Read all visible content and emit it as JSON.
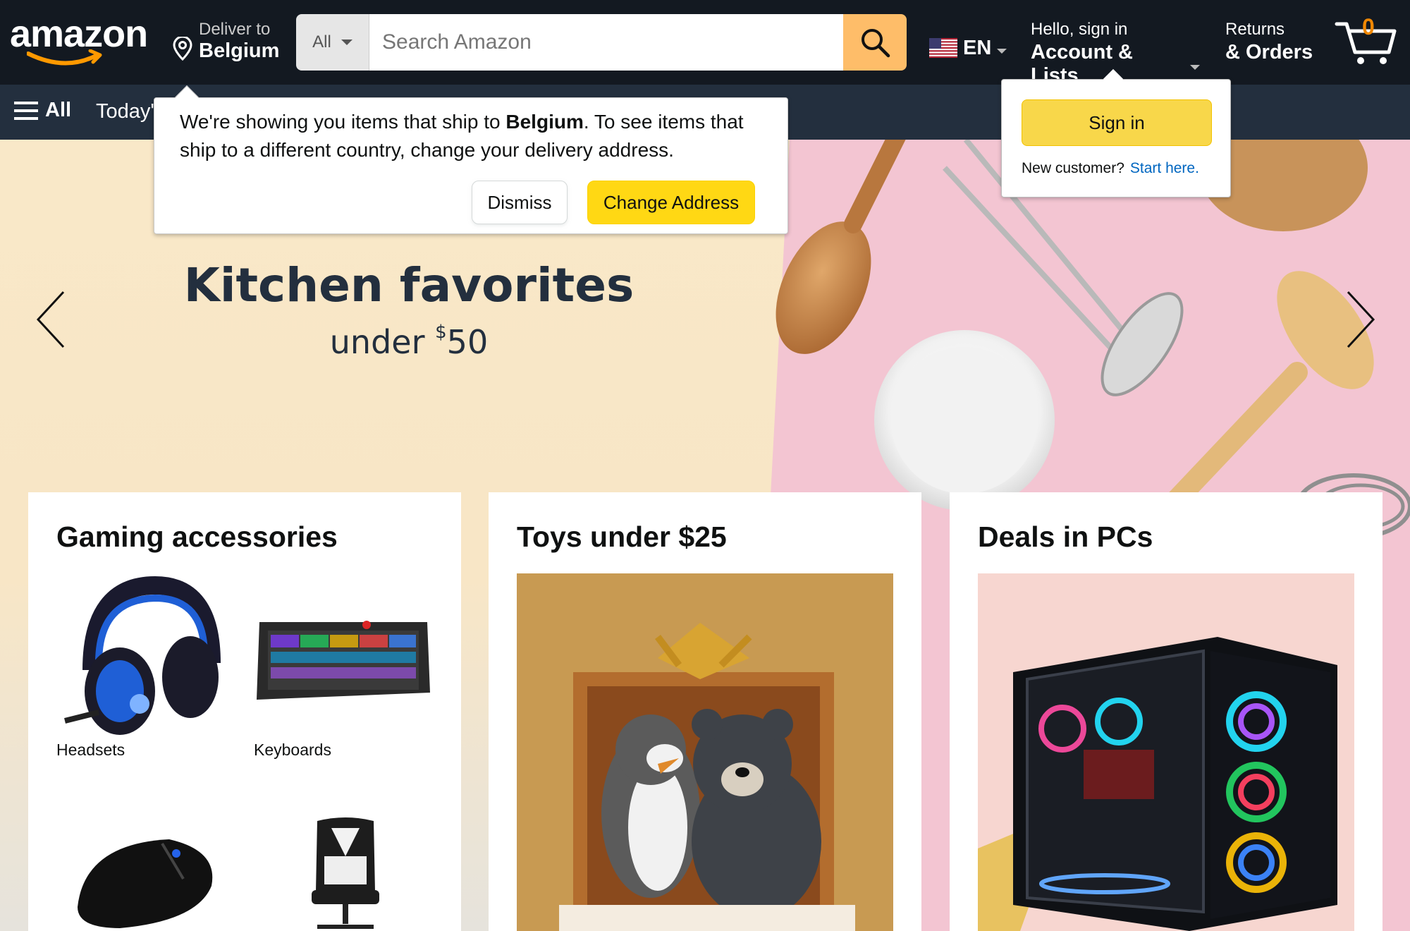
{
  "topnav": {
    "logo_text": "amazon",
    "deliver": {
      "line1": "Deliver to",
      "line2": "Belgium"
    },
    "search": {
      "category": "All",
      "placeholder": "Search Amazon",
      "value": ""
    },
    "language": {
      "code": "EN",
      "flag": "us-flag"
    },
    "account": {
      "line1": "Hello, sign in",
      "line2": "Account & Lists"
    },
    "returns": {
      "line1": "Returns",
      "line2": "& Orders"
    },
    "cart": {
      "count": "0"
    }
  },
  "subnav": {
    "all_label": "All",
    "items": [
      "Today's"
    ]
  },
  "hero": {
    "title": "Kitchen favorites",
    "subtitle_prefix": "under ",
    "subtitle_currency": "$",
    "subtitle_amount": "50"
  },
  "cards": [
    {
      "title": "Gaming accessories",
      "items": [
        {
          "label": "Headsets",
          "icon": "headset-image"
        },
        {
          "label": "Keyboards",
          "icon": "keyboard-image"
        },
        {
          "label": "",
          "icon": "mouse-image"
        },
        {
          "label": "",
          "icon": "gaming-chair-image"
        }
      ]
    },
    {
      "title": "Toys under $25",
      "image": "plush-toys-gift-box-image"
    },
    {
      "title": "Deals in PCs",
      "image": "gaming-pc-image"
    }
  ],
  "location_popover": {
    "message_before": "We're showing you items that ship to ",
    "message_country": "Belgium",
    "message_after": ". To see items that ship to a different country, change your delivery address.",
    "dismiss_label": "Dismiss",
    "change_label": "Change Address"
  },
  "signin_flyout": {
    "button_label": "Sign in",
    "new_customer_text": "New customer?",
    "start_link": "Start here."
  },
  "colors": {
    "nav_bg": "#131921",
    "subnav_bg": "#232f3e",
    "search_button": "#febd69",
    "accent_orange": "#f08804",
    "button_yellow": "#ffd814",
    "link_blue": "#0066c0"
  }
}
